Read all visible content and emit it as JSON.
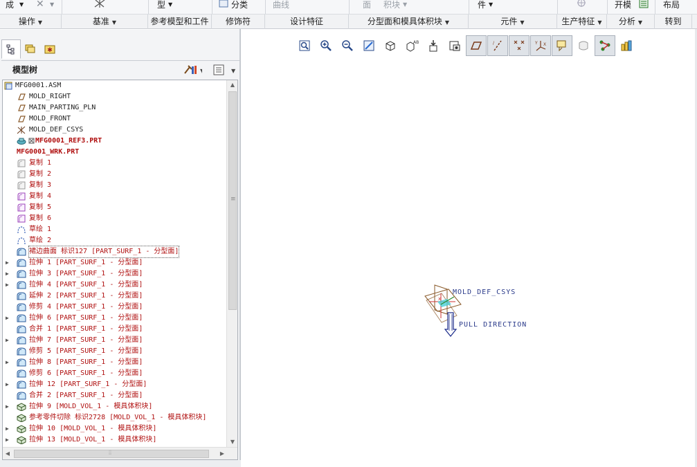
{
  "ribbon": {
    "top_items": {
      "cheng": "成",
      "x_label": "✕",
      "xing": "型",
      "fenlei": "分类",
      "quxian": "曲线",
      "mian": "面",
      "jikuai": "积块",
      "jian": "件",
      "kaimo": "开模",
      "buju": "布局"
    },
    "groups": [
      {
        "label": "操作",
        "dropdown": true
      },
      {
        "label": "基准",
        "dropdown": true
      },
      {
        "label": "参考模型和工件",
        "dropdown": false
      },
      {
        "label": "修饰符",
        "dropdown": false
      },
      {
        "label": "设计特征",
        "dropdown": false
      },
      {
        "label": "分型面和模具体积块",
        "dropdown": true
      },
      {
        "label": "元件",
        "dropdown": true
      },
      {
        "label": "生产特征",
        "dropdown": true
      },
      {
        "label": "分析",
        "dropdown": true
      },
      {
        "label": "转到",
        "dropdown": false
      }
    ]
  },
  "panel": {
    "tabs": [
      "model-tree-tab",
      "layer-tab",
      "favorites-tab"
    ],
    "tree_title": "模型树"
  },
  "tree": [
    {
      "label": "MFG0001.ASM",
      "icon": "assembly-icon",
      "indent": 0,
      "expander": false,
      "style": "normal"
    },
    {
      "label": "MOLD_RIGHT",
      "icon": "datum-plane-icon",
      "indent": 1,
      "expander": false,
      "style": "normal"
    },
    {
      "label": "MAIN_PARTING_PLN",
      "icon": "datum-plane-icon",
      "indent": 1,
      "expander": false,
      "style": "normal"
    },
    {
      "label": "MOLD_FRONT",
      "icon": "datum-plane-icon",
      "indent": 1,
      "expander": false,
      "style": "normal"
    },
    {
      "label": "MOLD_DEF_CSYS",
      "icon": "csys-icon",
      "indent": 1,
      "expander": false,
      "style": "normal"
    },
    {
      "label": "MFG0001_REF3.PRT",
      "icon": "ref-part-icon",
      "indent": 1,
      "expander": false,
      "style": "red-bold"
    },
    {
      "label": "MFG0001_WRK.PRT",
      "icon": "workpiece-icon",
      "indent": 1,
      "expander": false,
      "style": "red-bold"
    },
    {
      "label": "复制 1",
      "icon": "copy-gray-icon",
      "indent": 1,
      "expander": false,
      "style": "red"
    },
    {
      "label": "复制 2",
      "icon": "copy-gray-icon",
      "indent": 1,
      "expander": false,
      "style": "red"
    },
    {
      "label": "复制 3",
      "icon": "copy-gray-icon",
      "indent": 1,
      "expander": false,
      "style": "red"
    },
    {
      "label": "复制 4",
      "icon": "copy-purple-icon",
      "indent": 1,
      "expander": false,
      "style": "red"
    },
    {
      "label": "复制 5",
      "icon": "copy-purple-icon",
      "indent": 1,
      "expander": false,
      "style": "red"
    },
    {
      "label": "复制 6",
      "icon": "copy-purple-icon",
      "indent": 1,
      "expander": false,
      "style": "red"
    },
    {
      "label": "草绘 1",
      "icon": "sketch-icon",
      "indent": 1,
      "expander": false,
      "style": "red"
    },
    {
      "label": "草绘 2",
      "icon": "sketch-icon",
      "indent": 1,
      "expander": false,
      "style": "red"
    },
    {
      "label": "裙边曲面 标识127 [PART_SURF_1 - 分型面]",
      "icon": "surface-icon",
      "indent": 1,
      "expander": false,
      "style": "red-boxed"
    },
    {
      "label": "拉伸 1 [PART_SURF_1 - 分型面]",
      "icon": "surface-icon",
      "indent": 1,
      "expander": true,
      "style": "red"
    },
    {
      "label": "拉伸 3 [PART_SURF_1 - 分型面]",
      "icon": "surface-icon",
      "indent": 1,
      "expander": true,
      "style": "red"
    },
    {
      "label": "拉伸 4 [PART_SURF_1 - 分型面]",
      "icon": "surface-icon",
      "indent": 1,
      "expander": true,
      "style": "red"
    },
    {
      "label": "延伸 2 [PART_SURF_1 - 分型面]",
      "icon": "surface-icon",
      "indent": 1,
      "expander": false,
      "style": "red"
    },
    {
      "label": "修剪 4 [PART_SURF_1 - 分型面]",
      "icon": "surface-icon",
      "indent": 1,
      "expander": false,
      "style": "red"
    },
    {
      "label": "拉伸 6 [PART_SURF_1 - 分型面]",
      "icon": "surface-icon",
      "indent": 1,
      "expander": true,
      "style": "red"
    },
    {
      "label": "合并 1 [PART_SURF_1 - 分型面]",
      "icon": "surface-icon",
      "indent": 1,
      "expander": false,
      "style": "red"
    },
    {
      "label": "拉伸 7 [PART_SURF_1 - 分型面]",
      "icon": "surface-icon",
      "indent": 1,
      "expander": true,
      "style": "red"
    },
    {
      "label": "修剪 5 [PART_SURF_1 - 分型面]",
      "icon": "surface-icon",
      "indent": 1,
      "expander": false,
      "style": "red"
    },
    {
      "label": "拉伸 8 [PART_SURF_1 - 分型面]",
      "icon": "surface-icon",
      "indent": 1,
      "expander": true,
      "style": "red"
    },
    {
      "label": "修剪 6 [PART_SURF_1 - 分型面]",
      "icon": "surface-icon",
      "indent": 1,
      "expander": false,
      "style": "red"
    },
    {
      "label": "拉伸 12 [PART_SURF_1 - 分型面]",
      "icon": "surface-icon",
      "indent": 1,
      "expander": true,
      "style": "red"
    },
    {
      "label": "合并 2 [PART_SURF_1 - 分型面]",
      "icon": "surface-icon",
      "indent": 1,
      "expander": false,
      "style": "red"
    },
    {
      "label": "拉伸 9 [MOLD_VOL_1 - 模具体积块]",
      "icon": "volume-icon",
      "indent": 1,
      "expander": true,
      "style": "red"
    },
    {
      "label": "参考零件切除 标识2728 [MOLD_VOL_1 - 模具体积块]",
      "icon": "volume-icon",
      "indent": 1,
      "expander": false,
      "style": "red"
    },
    {
      "label": "拉伸 10 [MOLD_VOL_1 - 模具体积块]",
      "icon": "volume-icon",
      "indent": 1,
      "expander": true,
      "style": "red"
    },
    {
      "label": "拉伸 13 [MOLD_VOL_1 - 模具体积块]",
      "icon": "volume-icon",
      "indent": 1,
      "expander": true,
      "style": "red"
    }
  ],
  "toolbar": [
    {
      "name": "refit-button",
      "pressed": false
    },
    {
      "name": "zoom-in-button",
      "pressed": false
    },
    {
      "name": "zoom-out-button",
      "pressed": false
    },
    {
      "name": "repaint-button",
      "pressed": false
    },
    {
      "name": "display-style-button",
      "pressed": false
    },
    {
      "name": "saved-orientations-button",
      "pressed": false
    },
    {
      "name": "view-manager-button",
      "pressed": false
    },
    {
      "name": "perspective-button",
      "pressed": false
    },
    {
      "name": "plane-display-button",
      "pressed": true
    },
    {
      "name": "axis-display-button",
      "pressed": true
    },
    {
      "name": "point-display-button",
      "pressed": true
    },
    {
      "name": "csys-display-button",
      "pressed": true
    },
    {
      "name": "annotation-display-button",
      "pressed": true
    },
    {
      "name": "spin-center-button",
      "pressed": false
    },
    {
      "name": "network-display-button",
      "pressed": true
    },
    {
      "name": "layers-display-button",
      "pressed": false
    }
  ],
  "graphics": {
    "csys_label": "MOLD_DEF_CSYS",
    "pull_direction_label": "PULL DIRECTION"
  },
  "colors": {
    "tree_text_red": "#b01010",
    "graphics_label": "#2a3a8a",
    "accent_blue": "#1e6fd0"
  }
}
